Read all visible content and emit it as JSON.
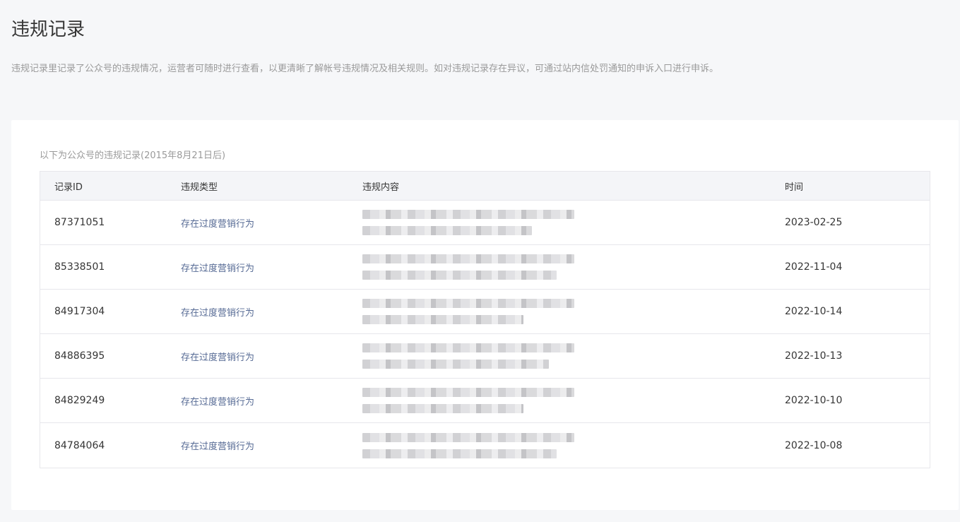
{
  "header": {
    "title": "违规记录",
    "description": "违规记录里记录了公众号的违规情况，运营者可随时进行查看，以更清晰了解帐号违规情况及相关规则。如对违规记录存在异议，可通过站内信处罚通知的申诉入口进行申诉。"
  },
  "records": {
    "caption": "以下为公众号的违规记录(2015年8月21日后)",
    "columns": [
      "记录ID",
      "违规类型",
      "违规内容",
      "时间"
    ],
    "rows": [
      {
        "id": "87371051",
        "type": "存在过度营销行为",
        "time": "2023-02-25"
      },
      {
        "id": "85338501",
        "type": "存在过度营销行为",
        "time": "2022-11-04"
      },
      {
        "id": "84917304",
        "type": "存在过度营销行为",
        "time": "2022-10-14"
      },
      {
        "id": "84886395",
        "type": "存在过度营销行为",
        "time": "2022-10-13"
      },
      {
        "id": "84829249",
        "type": "存在过度营销行为",
        "time": "2022-10-10"
      },
      {
        "id": "84784064",
        "type": "存在过度营销行为",
        "time": "2022-10-08"
      }
    ]
  },
  "colors": {
    "page_background": "#f6f7f9",
    "card_background": "#ffffff",
    "link_text": "#576b95",
    "muted_text": "#9a9a9a",
    "table_header_bg": "#f4f5f8",
    "border": "#e7e7eb"
  }
}
